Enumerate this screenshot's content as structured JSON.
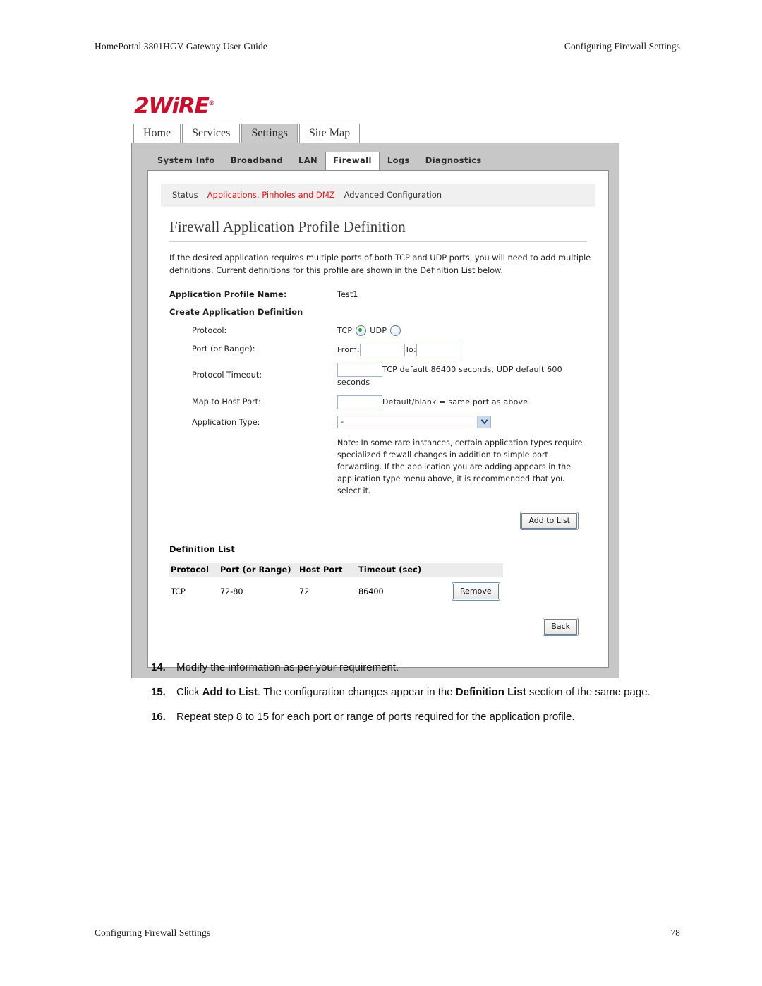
{
  "running_head": {
    "left": "HomePortal 3801HGV Gateway User Guide",
    "right": "Configuring Firewall Settings"
  },
  "running_foot": {
    "left": "Configuring Firewall Settings",
    "page_number": "78"
  },
  "screenshot": {
    "logo": {
      "text": "2WiRE",
      "registered": "®",
      "color": "#C8102E"
    },
    "top_tabs": [
      {
        "label": "Home",
        "active": false
      },
      {
        "label": "Services",
        "active": false
      },
      {
        "label": "Settings",
        "active": true
      },
      {
        "label": "Site Map",
        "active": false
      }
    ],
    "sub_tabs": [
      {
        "label": "System Info",
        "active": false
      },
      {
        "label": "Broadband",
        "active": false
      },
      {
        "label": "LAN",
        "active": false
      },
      {
        "label": "Firewall",
        "active": true
      },
      {
        "label": "Logs",
        "active": false
      },
      {
        "label": "Diagnostics",
        "active": false
      }
    ],
    "nav_bar": [
      {
        "label": "Status",
        "current": false
      },
      {
        "label": "Applications, Pinholes and DMZ",
        "current": true
      },
      {
        "label": "Advanced Configuration",
        "current": false
      }
    ],
    "page_title": "Firewall Application Profile Definition",
    "intro": "If the desired application requires multiple ports of both TCP and UDP ports, you will need to add multiple definitions. Current definitions for this profile are shown in the Definition List below.",
    "form": {
      "profile_name_label": "Application Profile Name:",
      "profile_name_value": "Test1",
      "create_definition_heading": "Create Application Definition",
      "protocol_label": "Protocol:",
      "protocol_tcp_label": "TCP",
      "protocol_udp_label": "UDP",
      "protocol_selected": "TCP",
      "port_label": "Port (or Range):",
      "port_from_label": "From:",
      "port_from_value": "",
      "port_to_label": "To:",
      "port_to_value": "",
      "timeout_label": "Protocol Timeout:",
      "timeout_value": "",
      "timeout_hint": "TCP default 86400 seconds, UDP default 600 seconds",
      "host_port_label": "Map to Host Port:",
      "host_port_value": "",
      "host_port_hint": "Default/blank = same port as above",
      "app_type_label": "Application Type:",
      "app_type_value": "-",
      "app_type_options": [
        "-"
      ],
      "note": "Note: In some rare instances, certain application types require specialized firewall changes in addition to simple port forwarding. If the application you are adding appears in the application type menu above, it is recommended that you select it."
    },
    "add_to_list_button": "Add to List",
    "definition_list": {
      "title": "Definition List",
      "columns": [
        "Protocol",
        "Port (or Range)",
        "Host Port",
        "Timeout (sec)"
      ],
      "rows": [
        {
          "protocol": "TCP",
          "port": "72-80",
          "host_port": "72",
          "timeout": "86400",
          "action": "Remove"
        }
      ]
    },
    "back_button": "Back"
  },
  "steps": [
    {
      "num": "14.",
      "parts": [
        {
          "t": "Modify the information as per your requirement.",
          "b": false
        }
      ]
    },
    {
      "num": "15.",
      "parts": [
        {
          "t": "Click ",
          "b": false
        },
        {
          "t": "Add to List",
          "b": true
        },
        {
          "t": ". The configuration changes appear in the ",
          "b": false
        },
        {
          "t": "Definition List",
          "b": true
        },
        {
          "t": " section of the same page.",
          "b": false
        }
      ]
    },
    {
      "num": "16.",
      "parts": [
        {
          "t": "Repeat step 8 to 15 for each port or range of ports required for the application profile.",
          "b": false
        }
      ]
    }
  ]
}
